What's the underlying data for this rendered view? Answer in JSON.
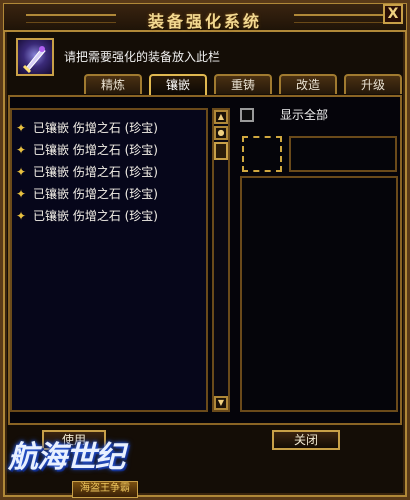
{
  "window": {
    "title": "装备强化系统",
    "close_glyph": "X"
  },
  "item_slot": {
    "prompt": "请把需要强化的装备放入此栏",
    "icon": "gem-sword-icon"
  },
  "tabs": [
    {
      "label": "精炼",
      "active": false
    },
    {
      "label": "镶嵌",
      "active": true
    },
    {
      "label": "重铸",
      "active": false
    },
    {
      "label": "改造",
      "active": false
    },
    {
      "label": "升级",
      "active": false
    }
  ],
  "socket_list": {
    "items": [
      {
        "label": "已镶嵌  伤增之石 (珍宝)"
      },
      {
        "label": "已镶嵌  伤增之石 (珍宝)"
      },
      {
        "label": "已镶嵌  伤增之石 (珍宝)"
      },
      {
        "label": "已镶嵌  伤增之石 (珍宝)"
      },
      {
        "label": "已镶嵌  伤增之石 (珍宝)"
      }
    ]
  },
  "show_all": {
    "label": "显示全部",
    "checked": false
  },
  "buttons": {
    "use": "使用",
    "close": "关闭"
  },
  "logo": {
    "text": "航海世纪",
    "sub": "海盗王争霸"
  },
  "colors": {
    "gold": "#c8a048",
    "bg": "#05040a",
    "title": "#f2d890"
  }
}
